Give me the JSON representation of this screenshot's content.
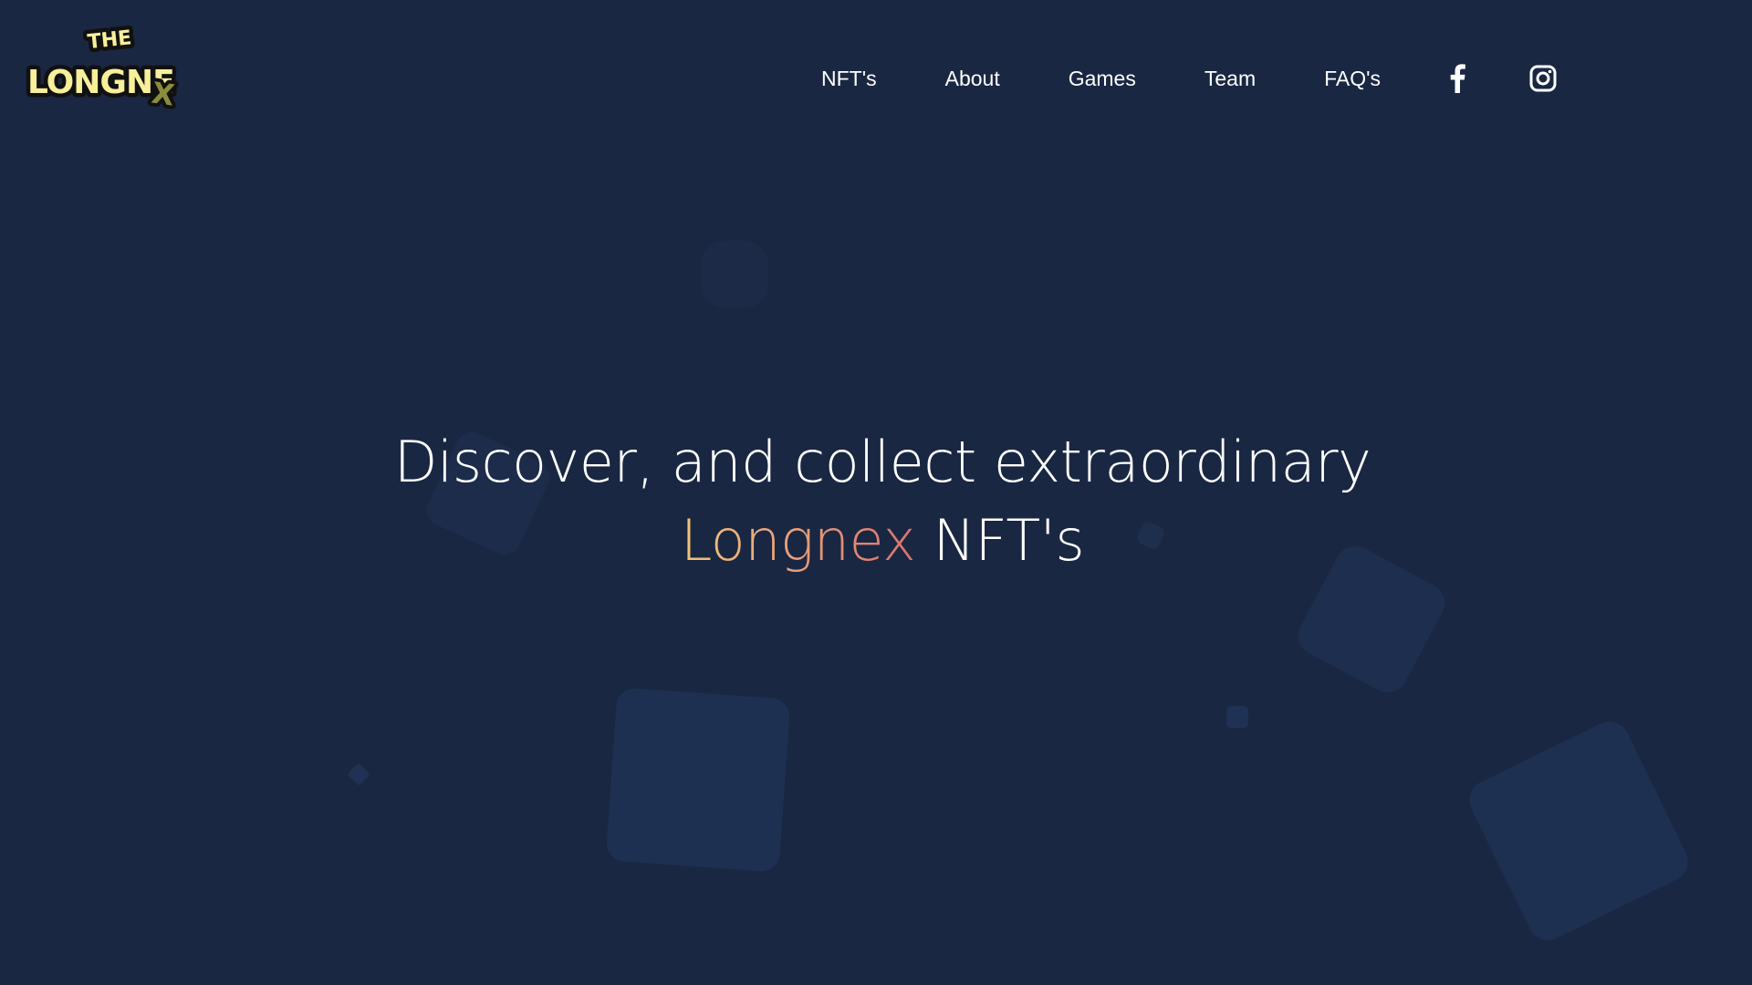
{
  "brand": {
    "logo_text": "THE LONGNEX",
    "logo_top": "THE",
    "logo_main": "LONGNE",
    "logo_x": "X"
  },
  "nav": {
    "links": [
      {
        "label": "NFT's"
      },
      {
        "label": "About"
      },
      {
        "label": "Games"
      },
      {
        "label": "Team"
      },
      {
        "label": "FAQ's"
      }
    ],
    "social": [
      {
        "icon": "facebook-icon"
      },
      {
        "icon": "instagram-icon"
      }
    ]
  },
  "hero": {
    "line1": "Discover, and collect extraordinary",
    "highlight": "Longnex",
    "line2_rest": "NFT's"
  },
  "colors": {
    "background": "#1a2742",
    "text": "#ffffff",
    "accent_start": "#f2c47a",
    "accent_end": "#d9736f",
    "logo_yellow": "#f7ef9a"
  }
}
